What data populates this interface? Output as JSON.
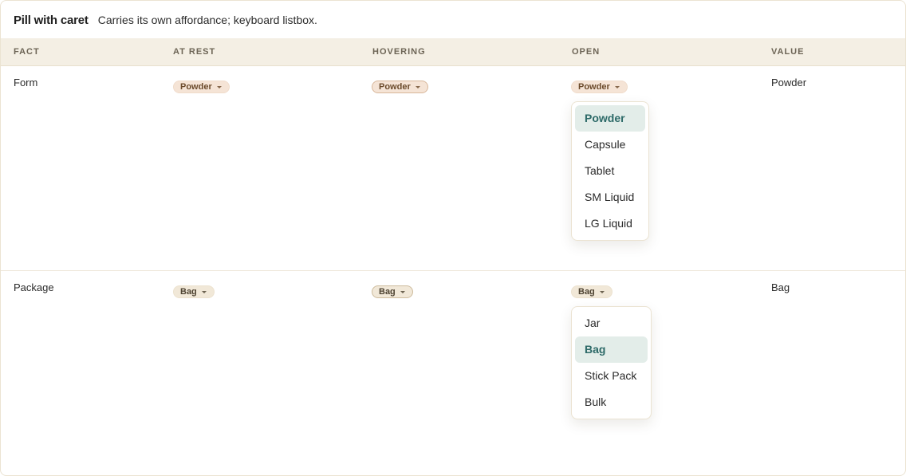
{
  "header": {
    "title": "Pill with caret",
    "subtitle": "Carries its own affordance; keyboard listbox."
  },
  "columns": [
    "FACT",
    "AT REST",
    "HOVERING",
    "OPEN",
    "VALUE"
  ],
  "rows": [
    {
      "fact": "Form",
      "rest_pill": "Powder",
      "hover_pill": "Powder",
      "open_pill": "Powder",
      "value": "Powder",
      "options": [
        "Powder",
        "Capsule",
        "Tablet",
        "SM Liquid",
        "LG Liquid"
      ],
      "selected_option": "Powder"
    },
    {
      "fact": "Package",
      "rest_pill": "Bag",
      "hover_pill": "Bag",
      "open_pill": "Bag",
      "value": "Bag",
      "options": [
        "Jar",
        "Bag",
        "Stick Pack",
        "Bulk"
      ],
      "selected_option": "Bag"
    }
  ],
  "colors": {
    "header_bg": "#f4efe4",
    "form_pill_bg": "#f5e4d6",
    "package_pill_bg": "#f1e8d8",
    "selected_option_bg": "#e3ede9",
    "selected_option_text": "#2d6a68"
  },
  "icons": {
    "pill_caret": "caret-down-icon"
  }
}
